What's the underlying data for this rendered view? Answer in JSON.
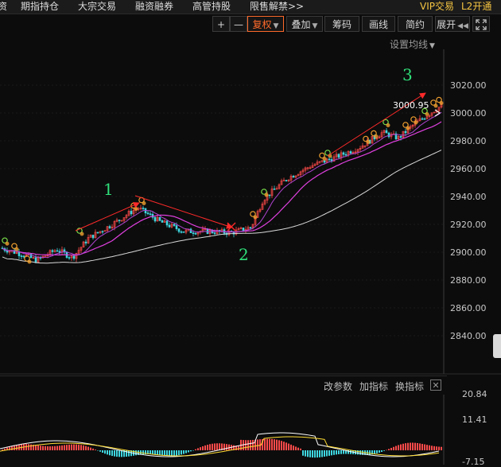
{
  "menu": [
    "资",
    "期指持仓",
    "大宗交易",
    "融资融券",
    "高管持股",
    "限售解禁>>"
  ],
  "vip": {
    "trade": "VIP交易",
    "l2": "L2开通"
  },
  "toolbar": {
    "plus": "+",
    "minus": "—",
    "fuquan": "复权",
    "diejia": "叠加",
    "chouma": "筹码",
    "huaxian": "画线",
    "jianyue": "简约",
    "zhankai": "展开"
  },
  "main": {
    "ma_settings": "设置均线",
    "price_ticks": [
      "3020.00",
      "3000.00",
      "2980.00",
      "2960.00",
      "2940.00",
      "2920.00",
      "2900.00",
      "2880.00",
      "2860.00",
      "2840.00"
    ],
    "last_price": "3000.95",
    "annotations": [
      "1",
      "2",
      "3"
    ]
  },
  "indicator": {
    "modify": "改参数",
    "add": "加指标",
    "switch": "换指标",
    "ticks": [
      "20.84",
      "11.41",
      "-7.15"
    ]
  },
  "watermark": "",
  "colors": {
    "up_candle": "#ff4a4a",
    "down_candle": "#3ed6e0",
    "ma_short": "#ffffff",
    "ma_mid": "#ffdd33",
    "ma_long": "#e040e0",
    "trend_line": "#ff2a2a",
    "annotation": "#2fe07a",
    "active": "#ff6a2a"
  }
}
